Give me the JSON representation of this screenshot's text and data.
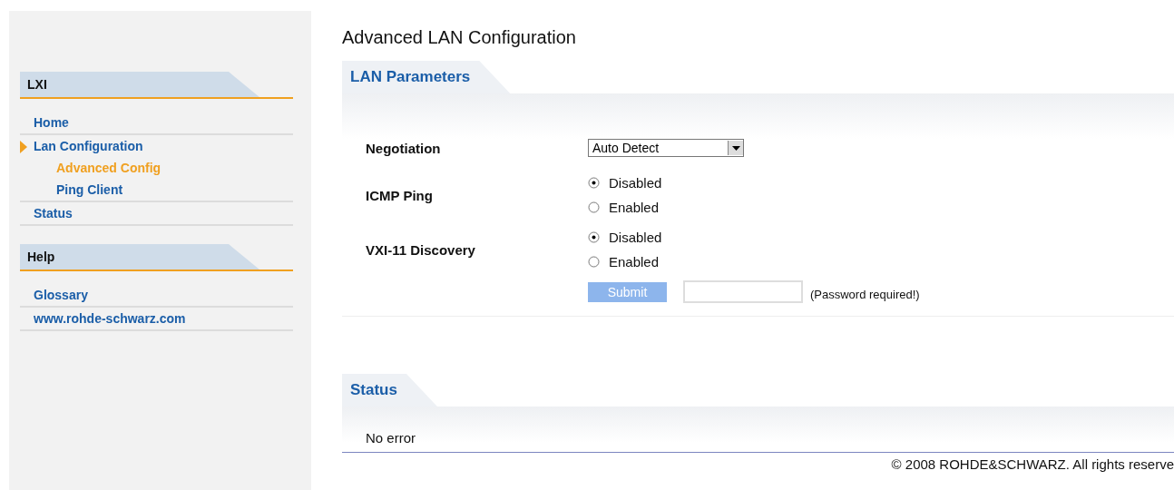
{
  "sidebar": {
    "sections": [
      {
        "title": "LXI",
        "items": [
          {
            "label": "Home",
            "selected": false,
            "expanded": false
          },
          {
            "label": "Lan Configuration",
            "selected": false,
            "expanded": true,
            "children": [
              {
                "label": "Advanced Config",
                "selected": true
              },
              {
                "label": "Ping Client",
                "selected": false
              }
            ]
          },
          {
            "label": "Status",
            "selected": false,
            "expanded": false
          }
        ]
      },
      {
        "title": "Help",
        "items": [
          {
            "label": "Glossary",
            "selected": false,
            "expanded": false
          },
          {
            "label": "www.rohde-schwarz.com",
            "selected": false,
            "expanded": false
          }
        ]
      }
    ]
  },
  "page_title": "Advanced LAN Configuration",
  "lan_parameters": {
    "tab": "LAN Parameters",
    "fields": [
      {
        "kind": "select",
        "label": "Negotiation",
        "value": "Auto Detect"
      },
      {
        "kind": "radio",
        "label": "ICMP Ping",
        "options": [
          {
            "label": "Disabled",
            "selected": true
          },
          {
            "label": "Enabled",
            "selected": false
          }
        ]
      },
      {
        "kind": "radio",
        "label": "VXI-11 Discovery",
        "options": [
          {
            "label": "Disabled",
            "selected": true
          },
          {
            "label": "Enabled",
            "selected": false
          }
        ]
      }
    ],
    "submit": "Submit",
    "password_note": "(Password required!)"
  },
  "status": {
    "tab": "Status",
    "message": "No error"
  },
  "footer": "© 2008 ROHDE&SCHWARZ. All rights reserve"
}
